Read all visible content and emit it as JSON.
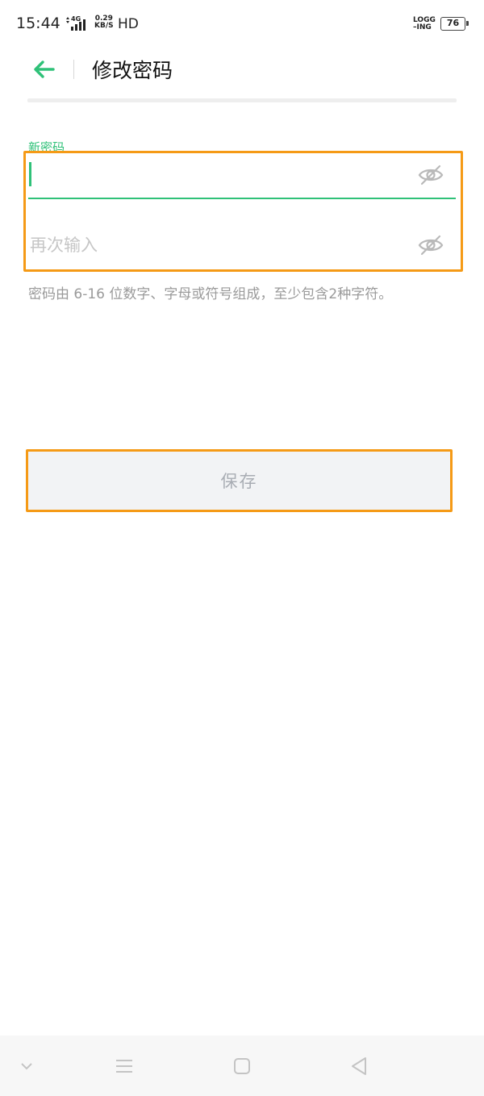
{
  "status_bar": {
    "time": "15:44",
    "network": "4G",
    "speed_value": "0.29",
    "speed_unit": "KB/S",
    "hd": "HD",
    "logging_top": "LOGG",
    "logging_bottom": "–ING",
    "battery": "76"
  },
  "header": {
    "title": "修改密码",
    "back_icon": "arrow-left-icon"
  },
  "form": {
    "new_password_label": "新密码",
    "new_password_value": "",
    "confirm_placeholder": "再次输入",
    "visibility_icon": "eye-off-icon",
    "hint": "密码由 6-16 位数字、字母或符号组成，至少包含2种字符。"
  },
  "save_button": {
    "label": "保存"
  },
  "nav_bar": {
    "icons": [
      "chevron-down-icon",
      "menu-icon",
      "home-square-icon",
      "back-triangle-icon"
    ]
  },
  "colors": {
    "accent": "#2fc178",
    "highlight": "#f59a16",
    "button_bg": "#f2f3f5",
    "button_text": "#a9adb4"
  }
}
